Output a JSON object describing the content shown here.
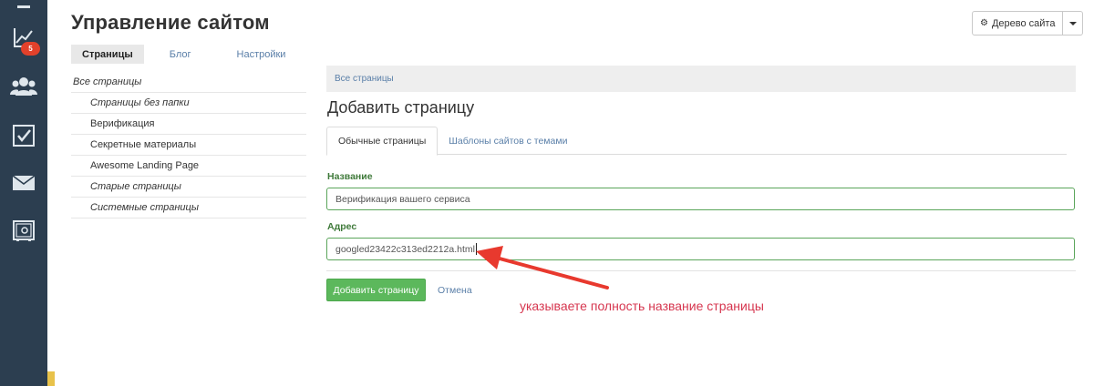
{
  "header": {
    "title": "Управление сайтом",
    "tree_button_label": "Дерево сайта"
  },
  "sidebar_rail": {
    "badge_count": "5",
    "icons": [
      "chart-icon",
      "users-icon",
      "checkbox-icon",
      "mail-icon",
      "safe-icon"
    ]
  },
  "top_tabs": [
    {
      "label": "Страницы",
      "active": true
    },
    {
      "label": "Блог",
      "active": false
    },
    {
      "label": "Настройки",
      "active": false
    }
  ],
  "page_list": {
    "root": "Все страницы",
    "items": [
      {
        "label": "Страницы без папки",
        "italic": true
      },
      {
        "label": "Верификация",
        "italic": false
      },
      {
        "label": "Секретные материалы",
        "italic": false
      },
      {
        "label": "Awesome Landing Page",
        "italic": false
      },
      {
        "label": "Старые страницы",
        "italic": true
      },
      {
        "label": "Системные страницы",
        "italic": true
      }
    ]
  },
  "breadcrumb": "Все страницы",
  "form": {
    "heading": "Добавить страницу",
    "tabs": [
      {
        "label": "Обычные страницы",
        "active": true
      },
      {
        "label": "Шаблоны сайтов с темами",
        "active": false
      }
    ],
    "name_label": "Название",
    "name_value": "Верификация вашего сервиса",
    "address_label": "Адрес",
    "address_value": "googled23422c313ed2212a.html",
    "submit_label": "Добавить страницу",
    "cancel_label": "Отмена"
  },
  "annotation": "указываете полность название страницы",
  "colors": {
    "rail": "#2c3e50",
    "primary_button": "#5cb85c",
    "link": "#5a7fa8",
    "annotation": "#d6364f",
    "badge": "#e2412b"
  }
}
